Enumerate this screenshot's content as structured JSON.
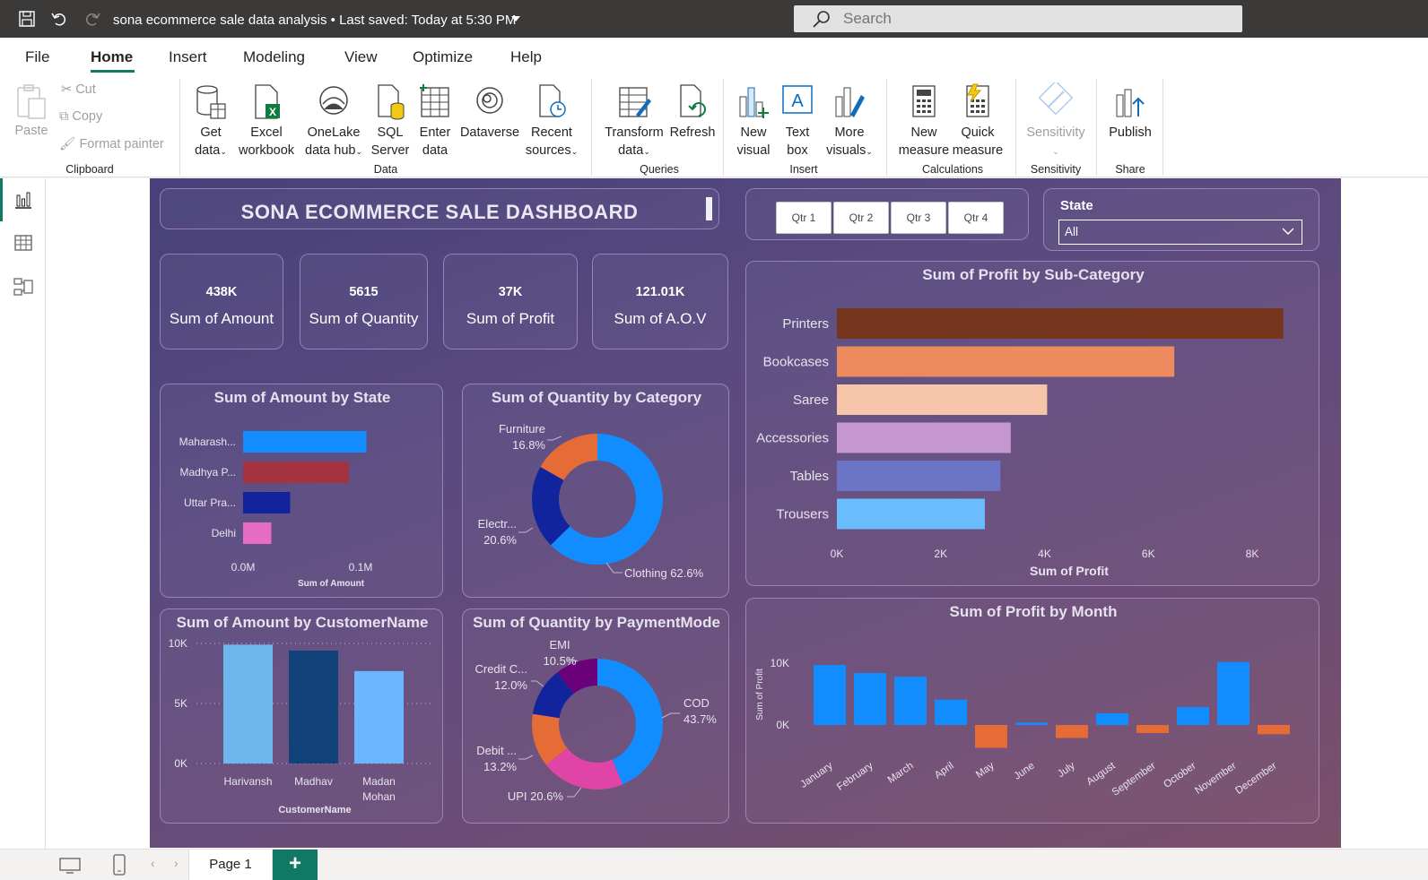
{
  "titlebar": {
    "title": "sona ecommerce sale data analysis",
    "saved": "Last saved: Today at 5:30 PM",
    "search_placeholder": "Search"
  },
  "menu": {
    "tabs": [
      "File",
      "Home",
      "Insert",
      "Modeling",
      "View",
      "Optimize",
      "Help"
    ],
    "active": "Home"
  },
  "ribbon": {
    "clipboard": {
      "paste": "Paste",
      "cut": "Cut",
      "copy": "Copy",
      "format_painter": "Format painter",
      "label": "Clipboard"
    },
    "data": {
      "get_data": [
        "Get",
        "data"
      ],
      "excel": [
        "Excel",
        "workbook"
      ],
      "onelake": [
        "OneLake",
        "data hub"
      ],
      "sql": [
        "SQL",
        "Server"
      ],
      "enter": [
        "Enter",
        "data"
      ],
      "dataverse": "Dataverse",
      "recent": [
        "Recent",
        "sources"
      ],
      "label": "Data"
    },
    "queries": {
      "transform": [
        "Transform",
        "data"
      ],
      "refresh": "Refresh",
      "label": "Queries"
    },
    "insert": {
      "new_visual": [
        "New",
        "visual"
      ],
      "text_box": [
        "Text",
        "box"
      ],
      "more_visuals": [
        "More",
        "visuals"
      ],
      "label": "Insert"
    },
    "calculations": {
      "new_measure": [
        "New",
        "measure"
      ],
      "quick_measure": [
        "Quick",
        "measure"
      ],
      "label": "Calculations"
    },
    "sensitivity": {
      "btn": "Sensitivity",
      "label": "Sensitivity"
    },
    "share": {
      "publish": "Publish",
      "label": "Share"
    }
  },
  "dashboard": {
    "title": "SONA ECOMMERCE SALE DASHBOARD",
    "quarters": [
      "Qtr 1",
      "Qtr 2",
      "Qtr 3",
      "Qtr 4"
    ],
    "state_filter": {
      "label": "State",
      "value": "All"
    },
    "kpis": [
      {
        "value": "438K",
        "label": "Sum of Amount"
      },
      {
        "value": "5615",
        "label": "Sum of Quantity"
      },
      {
        "value": "37K",
        "label": "Sum of Profit"
      },
      {
        "value": "121.01K",
        "label": "Sum of A.O.V"
      }
    ]
  },
  "chart_data": [
    {
      "id": "amount_by_state",
      "type": "bar",
      "orientation": "horizontal",
      "title": "Sum of Amount by State",
      "categories": [
        "Maharash...",
        "Madhya P...",
        "Uttar Pra...",
        "Delhi"
      ],
      "values": [
        0.105,
        0.09,
        0.04,
        0.024
      ],
      "colors": [
        "#118dff",
        "#a4323f",
        "#12239e",
        "#e66cc4"
      ],
      "xlabel": "Sum of Amount",
      "xticks": [
        "0.0M",
        "0.1M"
      ],
      "xlim": [
        0,
        0.1
      ]
    },
    {
      "id": "quantity_by_category",
      "type": "pie",
      "donut": true,
      "title": "Sum of Quantity by Category",
      "labels": [
        "Clothing",
        "Electr...",
        "Furniture"
      ],
      "values": [
        62.6,
        20.6,
        16.8
      ],
      "label_texts": [
        "Clothing 62.6%",
        "Electr...",
        "Furniture"
      ],
      "pct_texts": [
        "",
        "20.6%",
        "16.8%"
      ],
      "colors": [
        "#118dff",
        "#12239e",
        "#e66c37"
      ]
    },
    {
      "id": "profit_by_subcategory",
      "type": "bar",
      "orientation": "horizontal",
      "title": "Sum of Profit by Sub-Category",
      "categories": [
        "Printers",
        "Bookcases",
        "Saree",
        "Accessories",
        "Tables",
        "Trousers"
      ],
      "values": [
        8600,
        6500,
        4050,
        3350,
        3150,
        2850
      ],
      "colors": [
        "#76361e",
        "#ed8b5e",
        "#f6c4a8",
        "#c597d1",
        "#6c74c6",
        "#6bbcfd"
      ],
      "xlabel": "Sum of Profit",
      "xticks": [
        "0K",
        "2K",
        "4K",
        "6K",
        "8K"
      ],
      "xlim": [
        0,
        8000
      ]
    },
    {
      "id": "amount_by_customer",
      "type": "bar",
      "title": "Sum of Amount by CustomerName",
      "categories": [
        "Harivansh",
        "Madhav",
        "Madan Mohan"
      ],
      "category_lines": [
        [
          "Harivansh"
        ],
        [
          "Madhav"
        ],
        [
          "Madan",
          "Mohan"
        ]
      ],
      "values": [
        9900,
        9400,
        7700
      ],
      "colors": [
        "#6db7ee",
        "#12427a",
        "#6bb6fd"
      ],
      "xlabel": "CustomerName",
      "yticks": [
        "0K",
        "5K",
        "10K"
      ],
      "ylim": [
        0,
        10000
      ]
    },
    {
      "id": "quantity_by_paymentmode",
      "type": "pie",
      "donut": true,
      "title": "Sum of Quantity by PaymentMode",
      "labels": [
        "COD",
        "UPI",
        "Debit ...",
        "Credit C...",
        "EMI"
      ],
      "values": [
        43.7,
        20.6,
        13.2,
        12.0,
        10.5
      ],
      "label_texts": [
        "COD",
        "UPI 20.6%",
        "Debit ...",
        "Credit C...",
        "EMI"
      ],
      "pct_texts": [
        "43.7%",
        "",
        "13.2%",
        "12.0%",
        "10.5%"
      ],
      "colors": [
        "#118dff",
        "#e044a7",
        "#e66c37",
        "#12239e",
        "#6b007b"
      ]
    },
    {
      "id": "profit_by_month",
      "type": "bar",
      "title": "Sum of Profit by Month",
      "categories": [
        "January",
        "February",
        "March",
        "April",
        "May",
        "June",
        "July",
        "August",
        "September",
        "October",
        "November",
        "December"
      ],
      "values": [
        9700,
        8400,
        7800,
        4100,
        -3700,
        400,
        -2100,
        1900,
        -1300,
        2900,
        10200,
        -1500
      ],
      "pos_color": "#118dff",
      "neg_color": "#e66c37",
      "ylabel": "Sum of Profit",
      "yticks": [
        "0K",
        "10K"
      ],
      "ylim": [
        -4000,
        10000
      ]
    }
  ],
  "bottom": {
    "page": "Page 1",
    "add": "+"
  }
}
